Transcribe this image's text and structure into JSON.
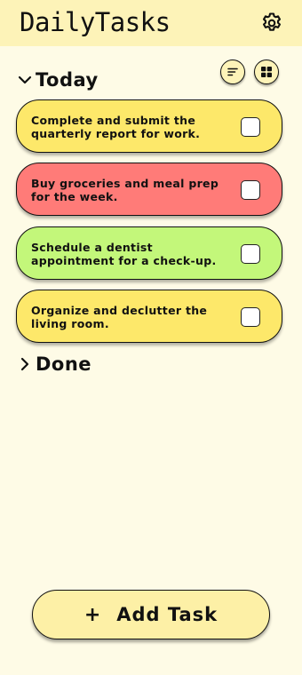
{
  "app": {
    "title": "DailyTasks"
  },
  "sections": {
    "today": {
      "label": "Today"
    },
    "done": {
      "label": "Done"
    }
  },
  "tasks": [
    {
      "text": "Complete and submit the quarterly report for work.",
      "color": "#fde86a",
      "checked": false
    },
    {
      "text": "Buy groceries and meal prep for the week.",
      "color": "#ff7b78",
      "checked": false
    },
    {
      "text": "Schedule a dentist appointment for a check-up.",
      "color": "#c3f77a",
      "checked": false
    },
    {
      "text": "Organize and declutter the living room.",
      "color": "#fde86a",
      "checked": false
    }
  ],
  "add_button": {
    "label": "Add Task"
  },
  "icons": {
    "settings": "gear-icon",
    "sort": "sort-icon",
    "view": "grid-view-icon",
    "expand_today": "chevron-down-icon",
    "expand_done": "chevron-right-icon",
    "add": "plus-icon"
  }
}
